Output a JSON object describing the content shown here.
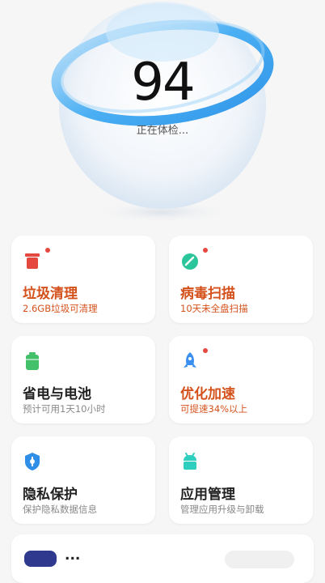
{
  "header": {
    "score": "94",
    "status": "正在体检..."
  },
  "cards": [
    {
      "title": "垃圾清理",
      "subtitle": "2.6GB垃圾可清理",
      "icon": "trash-icon",
      "alert": true,
      "color": "#e5483f"
    },
    {
      "title": "病毒扫描",
      "subtitle": "10天未全盘扫描",
      "icon": "shield-scan-icon",
      "alert": true,
      "color": "#2ac59b"
    },
    {
      "title": "省电与电池",
      "subtitle": "预计可用1天10小时",
      "icon": "battery-icon",
      "alert": false,
      "color": "#43c06a"
    },
    {
      "title": "优化加速",
      "subtitle": "可提速34%以上",
      "icon": "rocket-icon",
      "alert": true,
      "color": "#3b8ff0"
    },
    {
      "title": "隐私保护",
      "subtitle": "保护隐私数据信息",
      "icon": "privacy-shield-icon",
      "alert": false,
      "color": "#2f8ee6"
    },
    {
      "title": "应用管理",
      "subtitle": "管理应用升级与卸载",
      "icon": "android-icon",
      "alert": false,
      "color": "#2fcfc0"
    }
  ],
  "bottom": {
    "title": "..."
  }
}
